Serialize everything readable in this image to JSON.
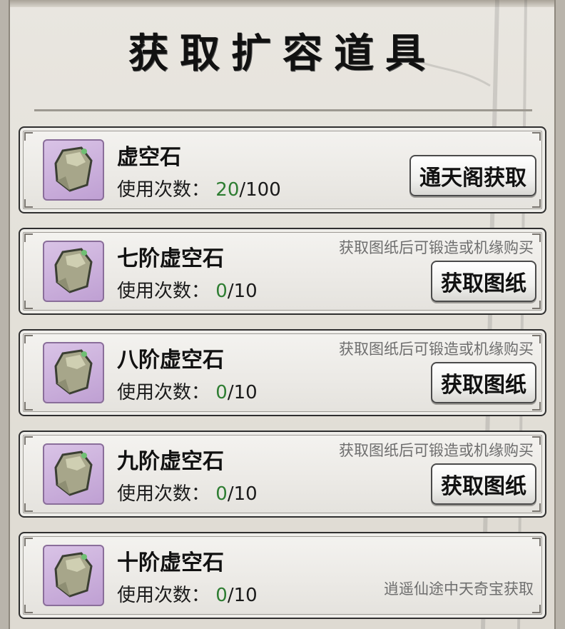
{
  "title": "获取扩容道具",
  "usage_label": "使用次数：",
  "items": [
    {
      "name": "虚空石",
      "current": "20",
      "sep_max": "/100",
      "hint": "",
      "button": "通天阁获取"
    },
    {
      "name": "七阶虚空石",
      "current": "0",
      "sep_max": "/10",
      "hint": "获取图纸后可锻造或机缘购买",
      "button": "获取图纸"
    },
    {
      "name": "八阶虚空石",
      "current": "0",
      "sep_max": "/10",
      "hint": "获取图纸后可锻造或机缘购买",
      "button": "获取图纸"
    },
    {
      "name": "九阶虚空石",
      "current": "0",
      "sep_max": "/10",
      "hint": "获取图纸后可锻造或机缘购买",
      "button": "获取图纸"
    },
    {
      "name": "十阶虚空石",
      "current": "0",
      "sep_max": "/10",
      "hint": "逍遥仙途中天奇宝获取",
      "button": ""
    }
  ],
  "colors": {
    "count_current": "#2e7d32",
    "icon_bg": "#c9aedb"
  },
  "icon": "void-stone-icon"
}
